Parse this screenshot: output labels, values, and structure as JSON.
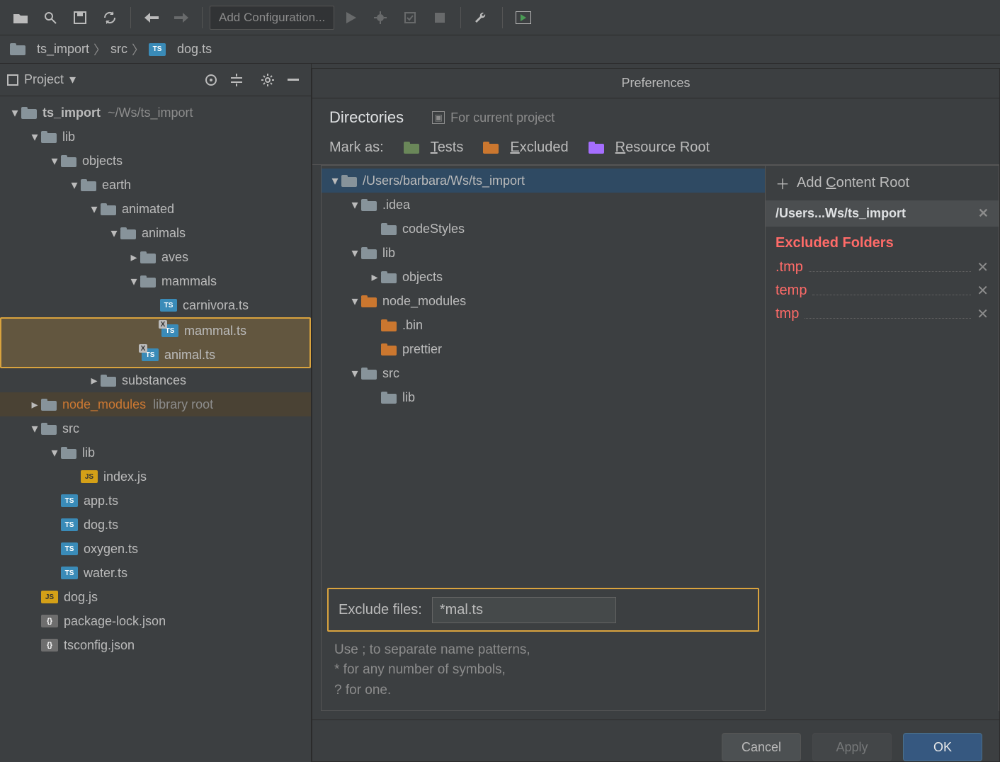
{
  "toolbar": {
    "config_label": "Add Configuration..."
  },
  "breadcrumbs": [
    "ts_import",
    "src",
    "dog.ts"
  ],
  "projectPanel": {
    "title": "Project",
    "root": {
      "name": "ts_import",
      "path": "~/Ws/ts_import"
    },
    "tree": {
      "lib": "lib",
      "objects": "objects",
      "earth": "earth",
      "animated": "animated",
      "animals": "animals",
      "aves": "aves",
      "mammals": "mammals",
      "carnivora": "carnivora.ts",
      "mammal": "mammal.ts",
      "animal": "animal.ts",
      "substances": "substances",
      "node_modules": "node_modules",
      "node_modules_note": "library root",
      "src": "src",
      "lib2": "lib",
      "index": "index.js",
      "app": "app.ts",
      "dog": "dog.ts",
      "oxygen": "oxygen.ts",
      "water": "water.ts",
      "dogjs": "dog.js",
      "pkglock": "package-lock.json",
      "tsconfig": "tsconfig.json"
    }
  },
  "prefs": {
    "title": "Preferences",
    "tab_directories": "Directories",
    "scope_label": "For current project",
    "markas": "Mark as:",
    "tests": "Tests",
    "excluded": "Excluded",
    "resource": "Resource Root",
    "rootPath": "/Users/barbara/Ws/ts_import",
    "tree": {
      "idea": ".idea",
      "codeStyles": "codeStyles",
      "lib": "lib",
      "objects": "objects",
      "node_modules": "node_modules",
      "bin": ".bin",
      "prettier": "prettier",
      "src": "src",
      "lib2": "lib"
    },
    "exclude_label": "Exclude files:",
    "exclude_value": "*mal.ts",
    "hint1": "Use ; to separate name patterns,",
    "hint2": "* for any number of symbols,",
    "hint3": "? for one.",
    "addRoot": "Add Content Root",
    "rootShort": "/Users...Ws/ts_import",
    "excludedHeader": "Excluded Folders",
    "excludedItems": [
      ".tmp",
      "temp",
      "tmp"
    ],
    "cancel": "Cancel",
    "apply": "Apply",
    "ok": "OK"
  }
}
